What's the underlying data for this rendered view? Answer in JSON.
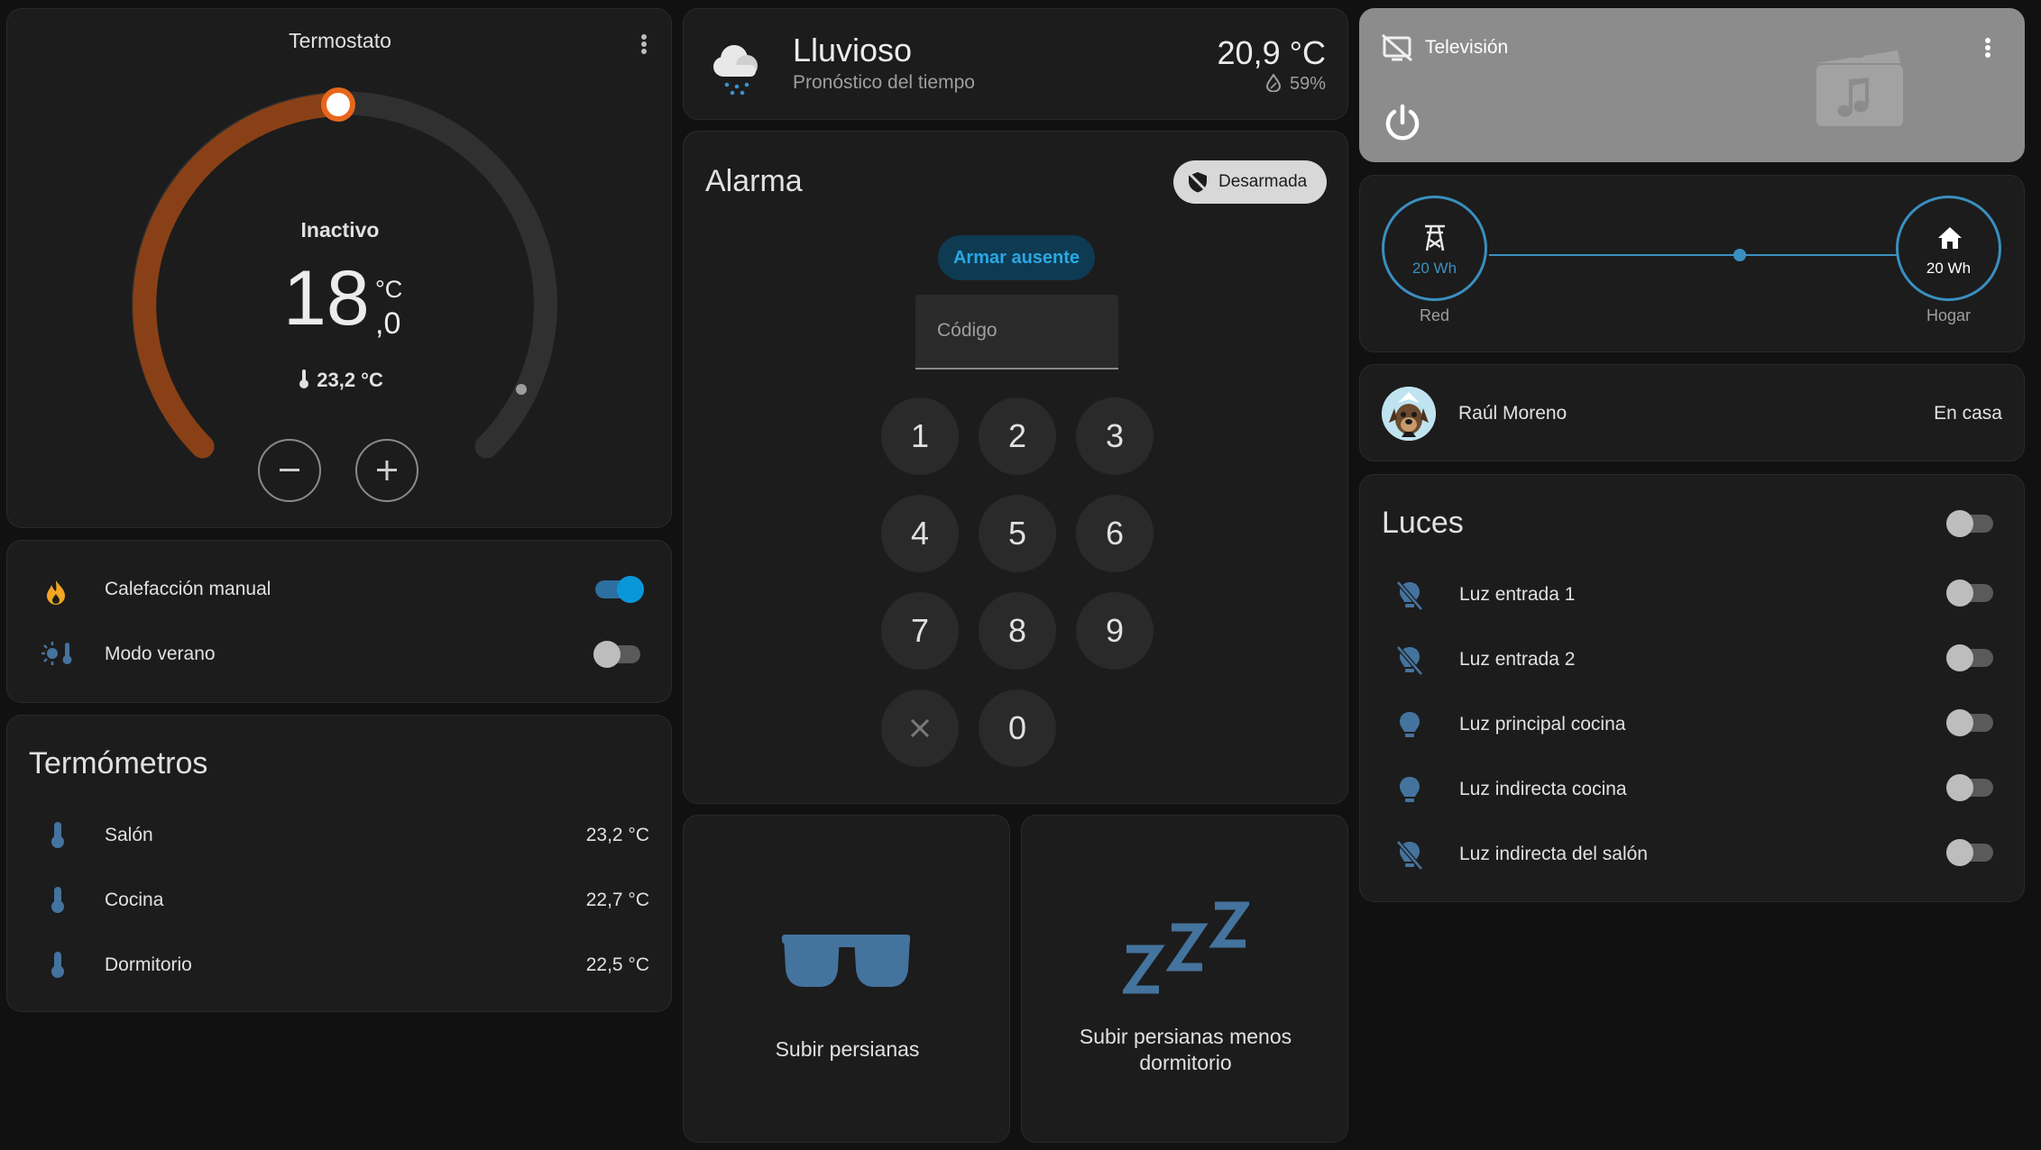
{
  "colors": {
    "background": "#111111",
    "card": "#1c1c1c",
    "heating_arc": "#8a4016",
    "accent_blue": "#0a97d9",
    "icon_blue": "#44739e",
    "energy_line": "#3a8fc0",
    "tv_card": "#8c8c8c"
  },
  "thermostat": {
    "title": "Termostato",
    "state": "Inactivo",
    "target_int": "18",
    "target_unit": "°C",
    "target_dec": ",0",
    "current": "23,2 °C"
  },
  "switches": [
    {
      "label": "Calefacción manual",
      "icon": "fire-icon",
      "on": true
    },
    {
      "label": "Modo verano",
      "icon": "sun-thermometer-icon",
      "on": false
    }
  ],
  "thermometers": {
    "title": "Termómetros",
    "items": [
      {
        "label": "Salón",
        "value": "23,2 °C"
      },
      {
        "label": "Cocina",
        "value": "22,7 °C"
      },
      {
        "label": "Dormitorio",
        "value": "22,5 °C"
      }
    ]
  },
  "weather": {
    "condition": "Lluvioso",
    "subtitle": "Pronóstico del tiempo",
    "temperature": "20,9 °C",
    "humidity": "59%"
  },
  "alarm": {
    "title": "Alarma",
    "state_badge": "Desarmada",
    "arm_button": "Armar ausente",
    "code_placeholder": "Código",
    "keys": [
      "1",
      "2",
      "3",
      "4",
      "5",
      "6",
      "7",
      "8",
      "9",
      "0"
    ]
  },
  "scenes": [
    {
      "label": "Subir persianas"
    },
    {
      "label_line1": "Subir persianas menos",
      "label_line2": "dormitorio"
    }
  ],
  "tv": {
    "title": "Televisión"
  },
  "energy": {
    "grid_value": "20 Wh",
    "grid_label": "Red",
    "home_value": "20 Wh",
    "home_label": "Hogar"
  },
  "person": {
    "name": "Raúl Moreno",
    "state": "En casa"
  },
  "lights": {
    "title": "Luces",
    "items": [
      {
        "label": "Luz entrada 1",
        "icon": "lightbulb-off-icon"
      },
      {
        "label": "Luz entrada 2",
        "icon": "lightbulb-off-icon"
      },
      {
        "label": "Luz principal cocina",
        "icon": "lightbulb-icon"
      },
      {
        "label": "Luz indirecta cocina",
        "icon": "lightbulb-icon"
      },
      {
        "label": "Luz indirecta del salón",
        "icon": "lightbulb-off-icon"
      }
    ]
  }
}
